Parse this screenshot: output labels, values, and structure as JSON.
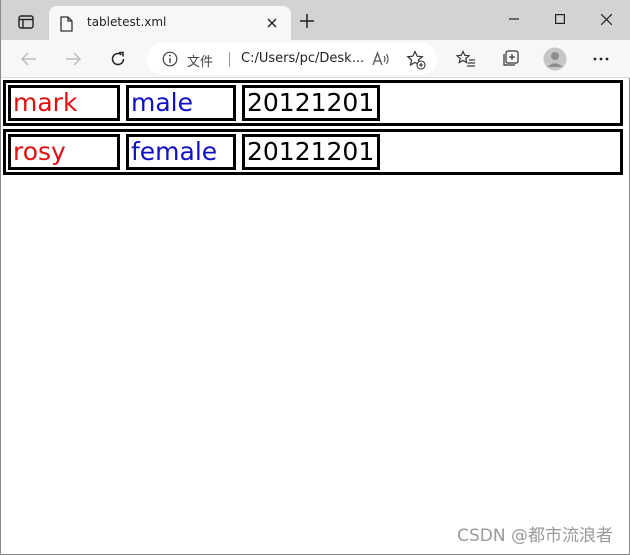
{
  "browser": {
    "tab": {
      "title": "tabletest.xml"
    },
    "address": {
      "file_label": "文件",
      "url": "C:/Users/pc/Desk..."
    }
  },
  "table": {
    "rows": [
      {
        "name": "mark",
        "gender": "male",
        "date": "20121201"
      },
      {
        "name": "rosy",
        "gender": "female",
        "date": "20121201"
      }
    ]
  },
  "colors": {
    "name": "#e01010",
    "gender": "#1010c8",
    "date": "#000000"
  },
  "watermark": "CSDN @都市流浪者"
}
